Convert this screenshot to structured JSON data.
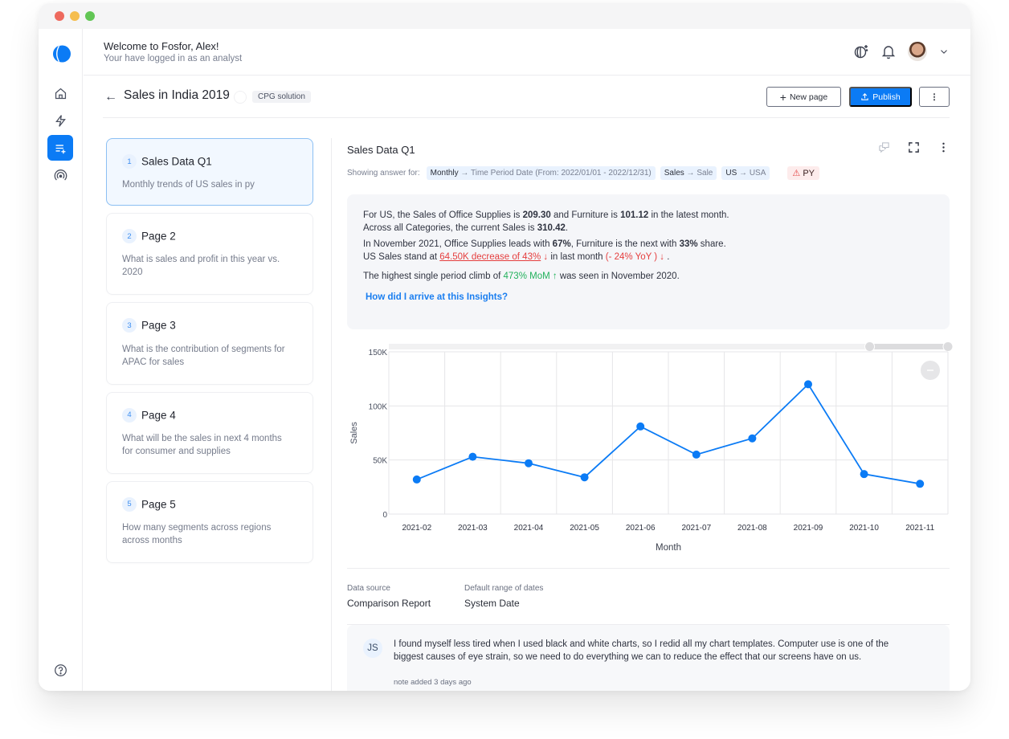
{
  "window": {
    "controls": [
      "close",
      "minimize",
      "maximize"
    ]
  },
  "rail": {
    "logo": "fosfor-logo",
    "items": [
      {
        "name": "home",
        "icon": "home-icon",
        "active": false
      },
      {
        "name": "insights",
        "icon": "bolt-icon",
        "active": false
      },
      {
        "name": "pages",
        "icon": "list-add-icon",
        "active": true
      },
      {
        "name": "signals",
        "icon": "broadcast-icon",
        "active": false
      }
    ],
    "help_icon": "help-circle-icon"
  },
  "header": {
    "welcome": "Welcome to Fosfor, Alex!",
    "subtitle": "Your have logged in as an analyst",
    "icons": [
      "theme-toggle-icon",
      "bell-icon",
      "avatar",
      "chevron-down-icon"
    ]
  },
  "toolbar": {
    "back_arrow": "←",
    "title": "Sales in India 2019",
    "tag": "CPG solution",
    "new_page": "New page",
    "publish": "Publish",
    "more": "⋮"
  },
  "pages": [
    {
      "num": "1",
      "title": "Sales Data Q1",
      "desc": "Monthly trends of US sales in py",
      "active": true
    },
    {
      "num": "2",
      "title": "Page 2",
      "desc": "What is sales and profit in this year vs. 2020",
      "active": false
    },
    {
      "num": "3",
      "title": "Page 3",
      "desc": "What is the contribution of segments for APAC for sales",
      "active": false
    },
    {
      "num": "4",
      "title": "Page 4",
      "desc": "What will be the sales in next 4 months for consumer and supplies",
      "active": false
    },
    {
      "num": "5",
      "title": "Page 5",
      "desc": "How many segments across regions across months",
      "active": false
    }
  ],
  "main": {
    "title": "Sales Data Q1",
    "showing_label": "Showing answer for:",
    "chips": [
      {
        "key": "Monthly",
        "value": "Time Period Date (From: 2022/01/01 - 2022/12/31)"
      },
      {
        "key": "Sales",
        "value": "Sale"
      },
      {
        "key": "US",
        "value": "USA"
      }
    ],
    "warning_chip": "PY",
    "insight": {
      "l1a": "For US, the Sales of Office Supplies is ",
      "l1b": "209.30",
      "l1c": " and Furniture is ",
      "l1d": "101.12",
      "l1e": " in the latest month.",
      "l2a": "Across all Categories, the current Sales is ",
      "l2b": "310.42",
      "l2c": ".",
      "l3a": "In November 2021, Office Supplies leads with ",
      "l3b": "67%",
      "l3c": ", Furniture is the next with ",
      "l3d": "33%",
      "l3e": " share.",
      "l4a": "US Sales stand at ",
      "l4b": "64.50K decrease of 43%",
      "l4c": " ↓",
      "l4d": " in last month ",
      "l4e": "(- 24% YoY ) ↓",
      "l4f": " .",
      "l5a": "The highest single period climb of ",
      "l5b": "473% MoM ↑",
      "l5c": "  was seen in November 2020.",
      "link": "How did I arrive at this Insights?"
    },
    "meta": [
      {
        "key": "Data source",
        "value": "Comparison Report"
      },
      {
        "key": "Default range of dates",
        "value": "System Date"
      }
    ],
    "note": {
      "initials": "JS",
      "text": "I found myself less tired when I used black and white charts, so I redid all my chart templates. Computer use is one of the biggest causes of eye strain, so we need to do everything we can to reduce the effect that our screens have on us.",
      "when": "note added 3 days ago"
    }
  },
  "chart_data": {
    "type": "line",
    "title": "",
    "xlabel": "Month",
    "ylabel": "Sales",
    "categories": [
      "2021-02",
      "2021-03",
      "2021-04",
      "2021-05",
      "2021-06",
      "2021-07",
      "2021-08",
      "2021-09",
      "2021-10",
      "2021-11"
    ],
    "series": [
      {
        "name": "Sales",
        "values": [
          32000,
          53000,
          47000,
          34000,
          81000,
          55000,
          70000,
          120000,
          37000,
          28000
        ],
        "color": "#0b7bf5"
      }
    ],
    "ylim": [
      0,
      150000
    ],
    "yticks": [
      0,
      50000,
      100000,
      150000
    ],
    "ytick_labels": [
      "0",
      "50K",
      "100K",
      "150K"
    ],
    "grid": true,
    "legend": "none",
    "zoom_range": [
      0.86,
      1.0
    ]
  }
}
